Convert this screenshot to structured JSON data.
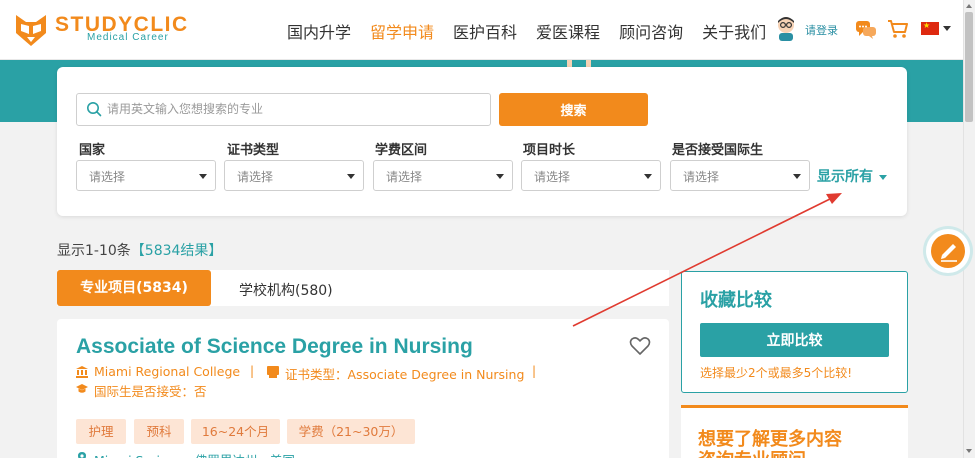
{
  "header": {
    "brand": "STUDYCLIC",
    "brand_sub": "Medical Career",
    "nav": [
      "国内升学",
      "留学申请",
      "医护百科",
      "爱医课程",
      "顾问咨询",
      "关于我们"
    ],
    "active_nav": "留学申请",
    "login": "请登录"
  },
  "search": {
    "placeholder": "请用英文输入您想搜索的专业",
    "button": "搜索"
  },
  "filters": [
    {
      "label": "国家",
      "placeholder": "请选择"
    },
    {
      "label": "证书类型",
      "placeholder": "请选择"
    },
    {
      "label": "学费区间",
      "placeholder": "请选择"
    },
    {
      "label": "项目时长",
      "placeholder": "请选择"
    },
    {
      "label": "是否接受国际生",
      "placeholder": "请选择"
    }
  ],
  "show_all": "显示所有",
  "results": {
    "range": "显示1-10条",
    "total": "【5834结果】"
  },
  "tabs": {
    "programs": "专业项目(5834)",
    "schools": "学校机构(580)"
  },
  "program": {
    "title": "Associate of Science Degree in Nursing",
    "school": "Miami Regional College",
    "cert": "证书类型：Associate Degree in Nursing",
    "intl": "国际生是否接受：否",
    "tags": [
      "护理",
      "预科",
      "16~24个月",
      "学费（21~30万）"
    ],
    "location": "Miami Springs，佛罗里达州，美国"
  },
  "compare": {
    "title": "收藏比较",
    "button": "立即比较",
    "note": "选择最少2个或最多5个比较!"
  },
  "info": {
    "title": "想要了解更多内容",
    "subtitle": "咨询专业顾问"
  },
  "colors": {
    "accent_orange": "#f28a1c",
    "accent_teal": "#2aa1a5",
    "annotation_arrow": "#e03b30"
  }
}
